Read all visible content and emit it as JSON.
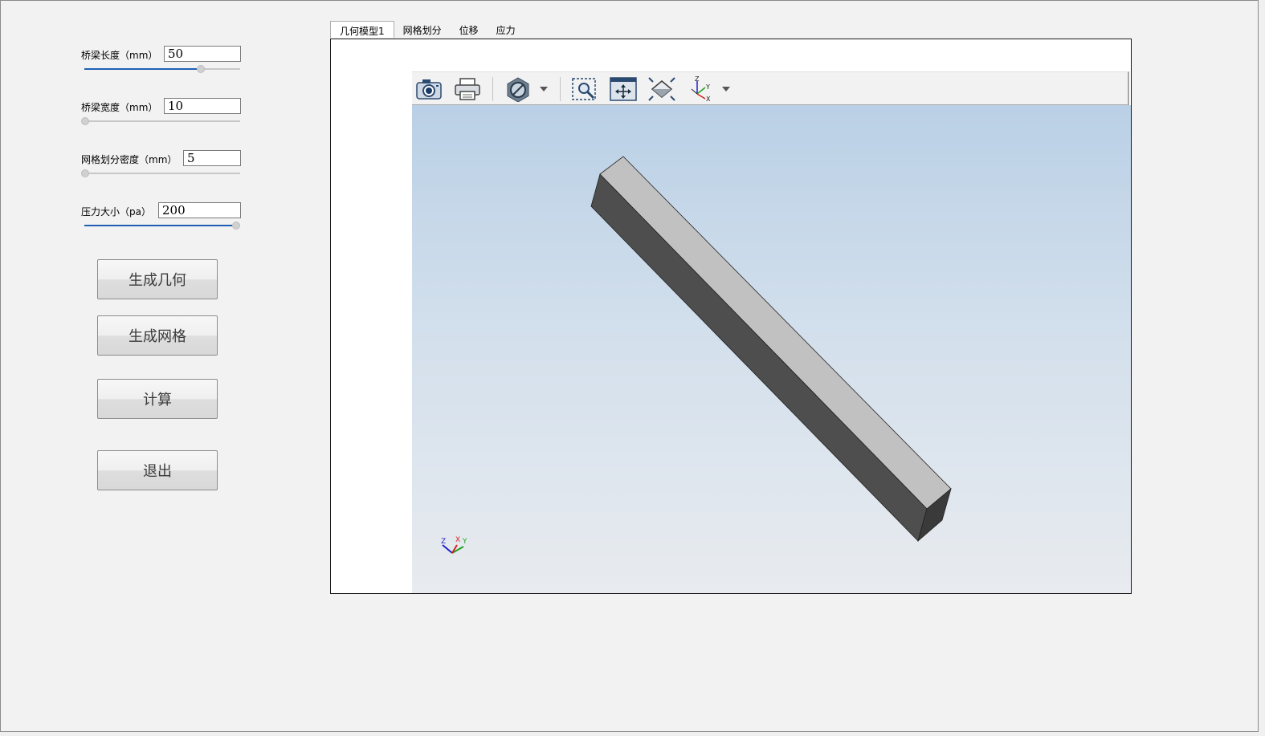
{
  "params": [
    {
      "label": "桥梁长度（mm）",
      "value": "50",
      "slider": 0.76
    },
    {
      "label": "桥梁宽度（mm）",
      "value": "10",
      "slider": 0.0
    },
    {
      "label": "网格划分密度（mm）",
      "value": "5",
      "slider": 0.0
    },
    {
      "label": "压力大小（pa）",
      "value": "200",
      "slider": 1.0
    }
  ],
  "buttons": {
    "geometry": "生成几何",
    "mesh": "生成网格",
    "compute": "计算",
    "exit": "退出"
  },
  "tabs": [
    "几何模型1",
    "网格划分",
    "位移",
    "应力"
  ],
  "toolbar": {
    "icons": [
      "camera-icon",
      "print-icon",
      "display-mode-icon",
      "zoom-box-icon",
      "fit-all-icon",
      "zoom-extents-icon",
      "view-axes-icon"
    ]
  },
  "triad": {
    "x": "X",
    "y": "Y",
    "z": "Z"
  },
  "colors": {
    "slider_fill": "#1f5fb5",
    "model_top": "#c1c1c1",
    "model_side": "#4e4e4e",
    "axis_x": "#d42020",
    "axis_y": "#22a022",
    "axis_z": "#2020d0"
  }
}
